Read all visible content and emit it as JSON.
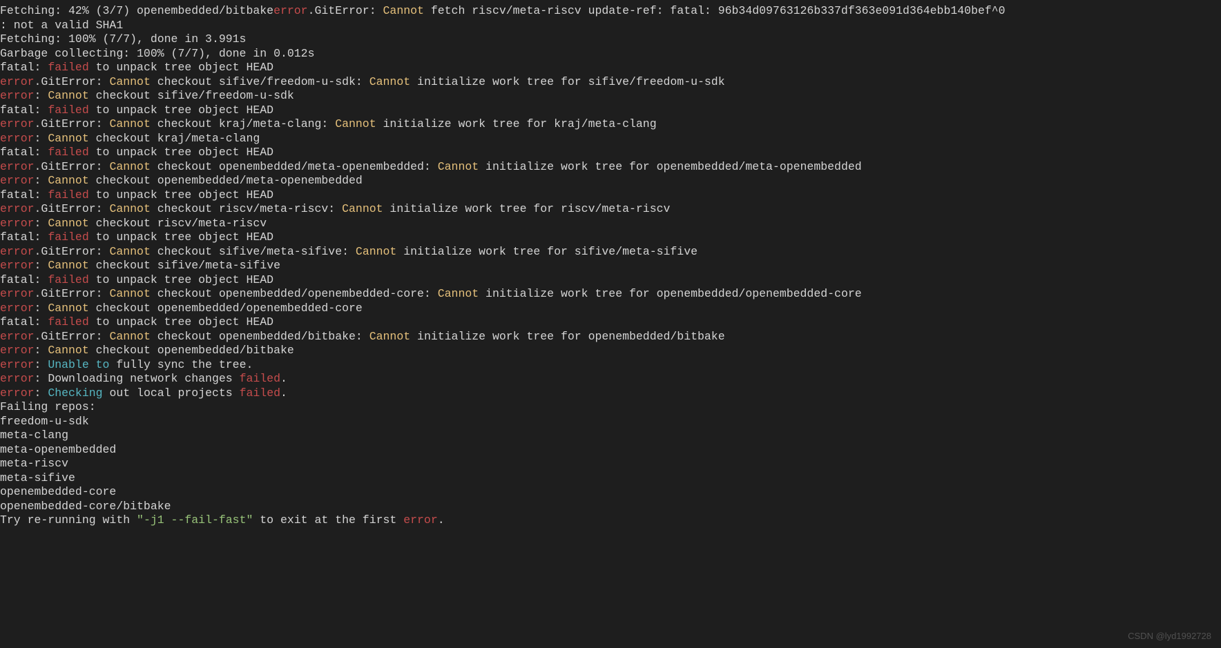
{
  "lines": [
    [
      [
        "w",
        "Fetching: 42% (3/7) openembedded/bitbake"
      ],
      [
        "r",
        "error"
      ],
      [
        "w",
        ".GitError: "
      ],
      [
        "y",
        "Cannot"
      ],
      [
        "w",
        " fetch riscv/meta-riscv update-ref: fatal: 96b34d09763126b337df363e091d364ebb140bef^0"
      ]
    ],
    [
      [
        "w",
        ": not a valid SHA1"
      ]
    ],
    [
      [
        "w",
        ""
      ]
    ],
    [
      [
        "w",
        "Fetching: 100% (7/7), done in 3.991s"
      ]
    ],
    [
      [
        "w",
        "Garbage collecting: 100% (7/7), done in 0.012s"
      ]
    ],
    [
      [
        "w",
        "fatal: "
      ],
      [
        "r",
        "failed"
      ],
      [
        "w",
        " to unpack tree object HEAD"
      ]
    ],
    [
      [
        "r",
        "error"
      ],
      [
        "w",
        ".GitError: "
      ],
      [
        "y",
        "Cannot"
      ],
      [
        "w",
        " checkout sifive/freedom-u-sdk: "
      ],
      [
        "y",
        "Cannot"
      ],
      [
        "w",
        " initialize work tree for sifive/freedom-u-sdk"
      ]
    ],
    [
      [
        "r",
        "error"
      ],
      [
        "w",
        ": "
      ],
      [
        "y",
        "Cannot"
      ],
      [
        "w",
        " checkout sifive/freedom-u-sdk"
      ]
    ],
    [
      [
        "w",
        "fatal: "
      ],
      [
        "r",
        "failed"
      ],
      [
        "w",
        " to unpack tree object HEAD"
      ]
    ],
    [
      [
        "r",
        "error"
      ],
      [
        "w",
        ".GitError: "
      ],
      [
        "y",
        "Cannot"
      ],
      [
        "w",
        " checkout kraj/meta-clang: "
      ],
      [
        "y",
        "Cannot"
      ],
      [
        "w",
        " initialize work tree for kraj/meta-clang"
      ]
    ],
    [
      [
        "r",
        "error"
      ],
      [
        "w",
        ": "
      ],
      [
        "y",
        "Cannot"
      ],
      [
        "w",
        " checkout kraj/meta-clang"
      ]
    ],
    [
      [
        "w",
        "fatal: "
      ],
      [
        "r",
        "failed"
      ],
      [
        "w",
        " to unpack tree object HEAD"
      ]
    ],
    [
      [
        "r",
        "error"
      ],
      [
        "w",
        ".GitError: "
      ],
      [
        "y",
        "Cannot"
      ],
      [
        "w",
        " checkout openembedded/meta-openembedded: "
      ],
      [
        "y",
        "Cannot"
      ],
      [
        "w",
        " initialize work tree for openembedded/meta-openembedded"
      ]
    ],
    [
      [
        "r",
        "error"
      ],
      [
        "w",
        ": "
      ],
      [
        "y",
        "Cannot"
      ],
      [
        "w",
        " checkout openembedded/meta-openembedded"
      ]
    ],
    [
      [
        "w",
        "fatal: "
      ],
      [
        "r",
        "failed"
      ],
      [
        "w",
        " to unpack tree object HEAD"
      ]
    ],
    [
      [
        "r",
        "error"
      ],
      [
        "w",
        ".GitError: "
      ],
      [
        "y",
        "Cannot"
      ],
      [
        "w",
        " checkout riscv/meta-riscv: "
      ],
      [
        "y",
        "Cannot"
      ],
      [
        "w",
        " initialize work tree for riscv/meta-riscv"
      ]
    ],
    [
      [
        "r",
        "error"
      ],
      [
        "w",
        ": "
      ],
      [
        "y",
        "Cannot"
      ],
      [
        "w",
        " checkout riscv/meta-riscv"
      ]
    ],
    [
      [
        "w",
        "fatal: "
      ],
      [
        "r",
        "failed"
      ],
      [
        "w",
        " to unpack tree object HEAD"
      ]
    ],
    [
      [
        "r",
        "error"
      ],
      [
        "w",
        ".GitError: "
      ],
      [
        "y",
        "Cannot"
      ],
      [
        "w",
        " checkout sifive/meta-sifive: "
      ],
      [
        "y",
        "Cannot"
      ],
      [
        "w",
        " initialize work tree for sifive/meta-sifive"
      ]
    ],
    [
      [
        "r",
        "error"
      ],
      [
        "w",
        ": "
      ],
      [
        "y",
        "Cannot"
      ],
      [
        "w",
        " checkout sifive/meta-sifive"
      ]
    ],
    [
      [
        "w",
        "fatal: "
      ],
      [
        "r",
        "failed"
      ],
      [
        "w",
        " to unpack tree object HEAD"
      ]
    ],
    [
      [
        "r",
        "error"
      ],
      [
        "w",
        ".GitError: "
      ],
      [
        "y",
        "Cannot"
      ],
      [
        "w",
        " checkout openembedded/openembedded-core: "
      ],
      [
        "y",
        "Cannot"
      ],
      [
        "w",
        " initialize work tree for openembedded/openembedded-core"
      ]
    ],
    [
      [
        "r",
        "error"
      ],
      [
        "w",
        ": "
      ],
      [
        "y",
        "Cannot"
      ],
      [
        "w",
        " checkout openembedded/openembedded-core"
      ]
    ],
    [
      [
        "w",
        "fatal: "
      ],
      [
        "r",
        "failed"
      ],
      [
        "w",
        " to unpack tree object HEAD"
      ]
    ],
    [
      [
        "r",
        "error"
      ],
      [
        "w",
        ".GitError: "
      ],
      [
        "y",
        "Cannot"
      ],
      [
        "w",
        " checkout openembedded/bitbake: "
      ],
      [
        "y",
        "Cannot"
      ],
      [
        "w",
        " initialize work tree for openembedded/bitbake"
      ]
    ],
    [
      [
        "r",
        "error"
      ],
      [
        "w",
        ": "
      ],
      [
        "y",
        "Cannot"
      ],
      [
        "w",
        " checkout openembedded/bitbake"
      ]
    ],
    [
      [
        "w",
        ""
      ]
    ],
    [
      [
        "r",
        "error"
      ],
      [
        "w",
        ": "
      ],
      [
        "cy",
        "Unable to"
      ],
      [
        "w",
        " fully sync the tree."
      ]
    ],
    [
      [
        "r",
        "error"
      ],
      [
        "w",
        ": Downloading network changes "
      ],
      [
        "r",
        "failed"
      ],
      [
        "w",
        "."
      ]
    ],
    [
      [
        "r",
        "error"
      ],
      [
        "w",
        ": "
      ],
      [
        "cy",
        "Checking"
      ],
      [
        "w",
        " out local projects "
      ],
      [
        "r",
        "failed"
      ],
      [
        "w",
        "."
      ]
    ],
    [
      [
        "w",
        "Failing repos:"
      ]
    ],
    [
      [
        "w",
        "freedom-u-sdk"
      ]
    ],
    [
      [
        "w",
        "meta-clang"
      ]
    ],
    [
      [
        "w",
        "meta-openembedded"
      ]
    ],
    [
      [
        "w",
        "meta-riscv"
      ]
    ],
    [
      [
        "w",
        "meta-sifive"
      ]
    ],
    [
      [
        "w",
        "openembedded-core"
      ]
    ],
    [
      [
        "w",
        "openembedded-core/bitbake"
      ]
    ],
    [
      [
        "w",
        "Try re-running with "
      ],
      [
        "g",
        "\"-j1 --fail-fast\""
      ],
      [
        "w",
        " to exit at the first "
      ],
      [
        "r",
        "error"
      ],
      [
        "w",
        "."
      ]
    ]
  ],
  "watermark": "CSDN @lyd1992728"
}
